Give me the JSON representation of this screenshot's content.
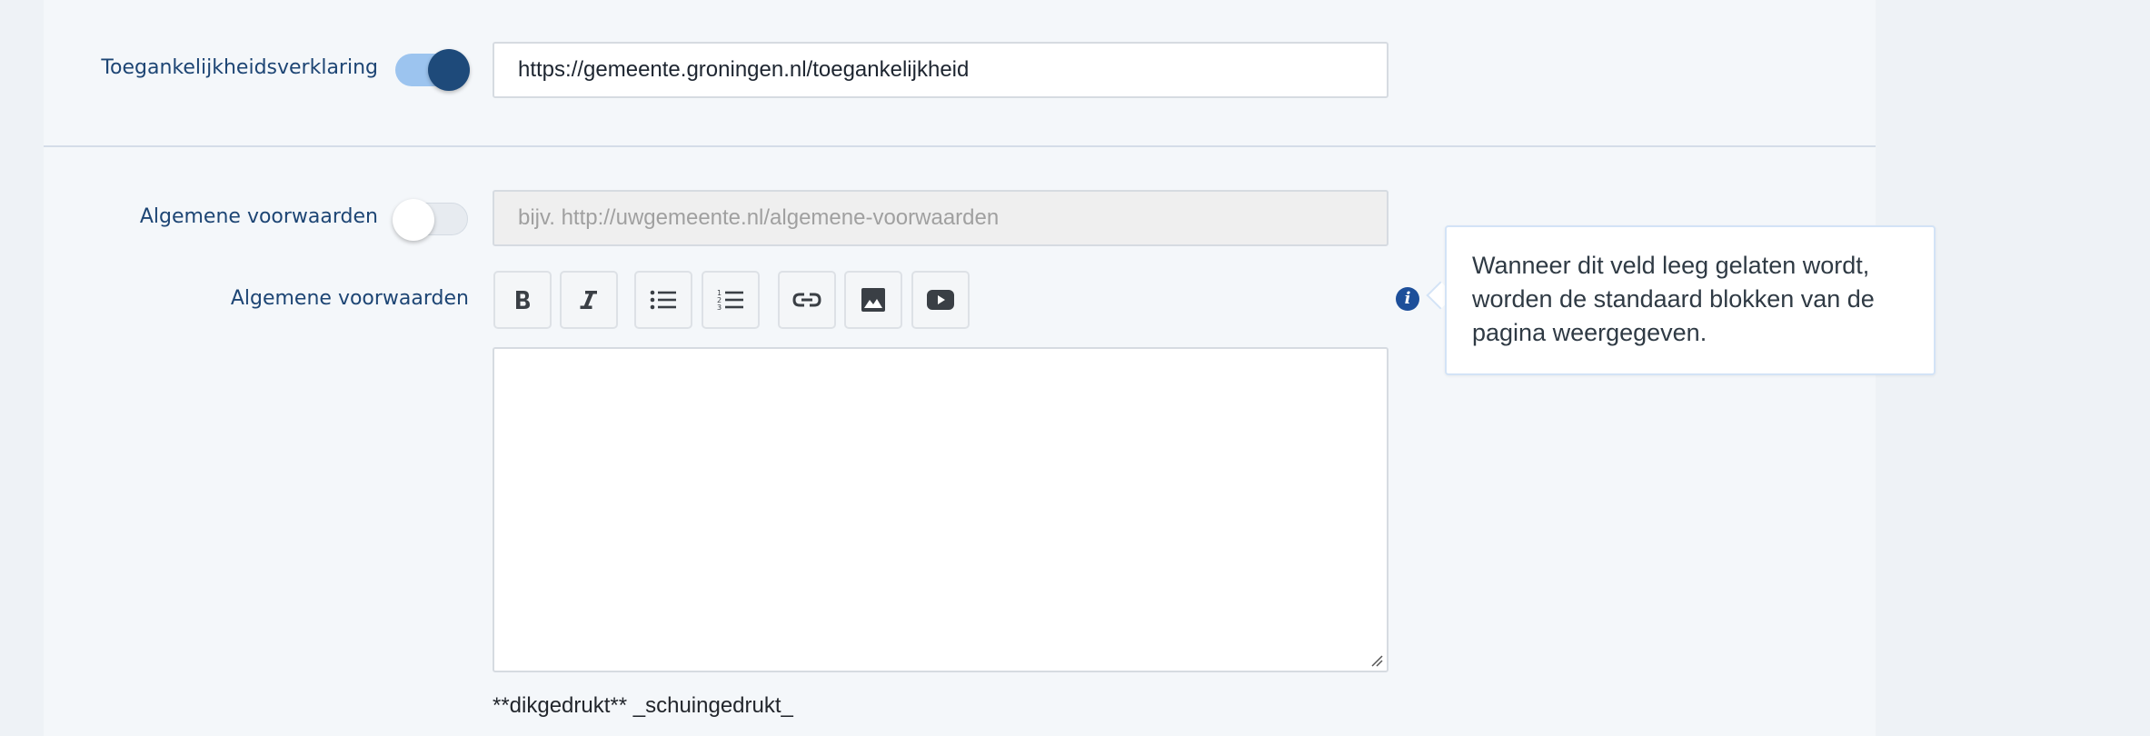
{
  "accessibility": {
    "label": "Toegankelijkheidsverklaring",
    "toggle_on": true,
    "url_value": "https://gemeente.groningen.nl/toegankelijkheid"
  },
  "terms": {
    "label": "Algemene voorwaarden",
    "toggle_on": false,
    "url_placeholder": "bijv. http://uwgemeente.nl/algemene-voorwaarden"
  },
  "terms_text": {
    "label": "Algemene voorwaarden",
    "toolbar": [
      {
        "name": "bold",
        "icon": "bold-icon"
      },
      {
        "name": "italic",
        "icon": "italic-icon"
      },
      {
        "name": "bulleted-list",
        "icon": "bulleted-list-icon"
      },
      {
        "name": "numbered-list",
        "icon": "numbered-list-icon"
      },
      {
        "name": "link",
        "icon": "link-icon"
      },
      {
        "name": "image",
        "icon": "image-icon"
      },
      {
        "name": "video",
        "icon": "video-icon"
      }
    ],
    "editor_value": "",
    "markdown_hint": "**dikgedrukt** _schuingedrukt_",
    "tooltip": "Wanneer dit veld leeg gelaten wordt, worden de standaard blokken van de pagina weergegeven."
  },
  "colors": {
    "label": "#1d4574",
    "toggle_on_track": "#9cc4ef",
    "toggle_on_knob": "#1e4a7a",
    "info_icon": "#1d4f9a",
    "panel_background": "#f4f7fa",
    "page_background": "#eef2f6"
  }
}
